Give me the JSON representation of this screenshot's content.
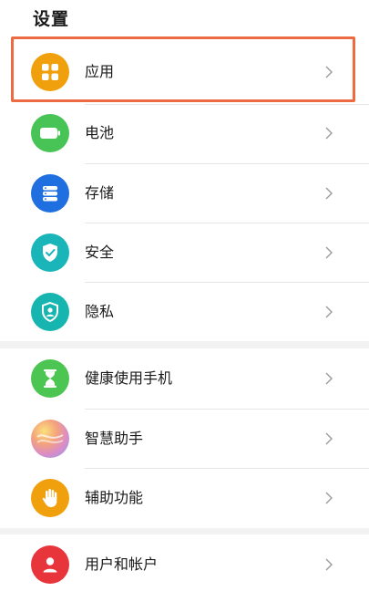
{
  "header": {
    "title": "设置"
  },
  "items": [
    {
      "label": "应用",
      "icon": "apps-grid-icon",
      "color": "#f0a00d"
    },
    {
      "label": "电池",
      "icon": "battery-icon",
      "color": "#48c456"
    },
    {
      "label": "存储",
      "icon": "storage-icon",
      "color": "#1f6fe0"
    },
    {
      "label": "安全",
      "icon": "shield-check-icon",
      "color": "#1ab5b8"
    },
    {
      "label": "隐私",
      "icon": "privacy-shield-icon",
      "color": "#17b5b0"
    },
    {
      "label": "健康使用手机",
      "icon": "hourglass-icon",
      "color": "#4cc552"
    },
    {
      "label": "智慧助手",
      "icon": "assistant-orb-icon",
      "color": "#d98bc9"
    },
    {
      "label": "辅助功能",
      "icon": "hand-icon",
      "color": "#f0a00d"
    },
    {
      "label": "用户和帐户",
      "icon": "user-account-icon",
      "color": "#e8343b"
    }
  ],
  "highlight_color": "#ec6b43"
}
